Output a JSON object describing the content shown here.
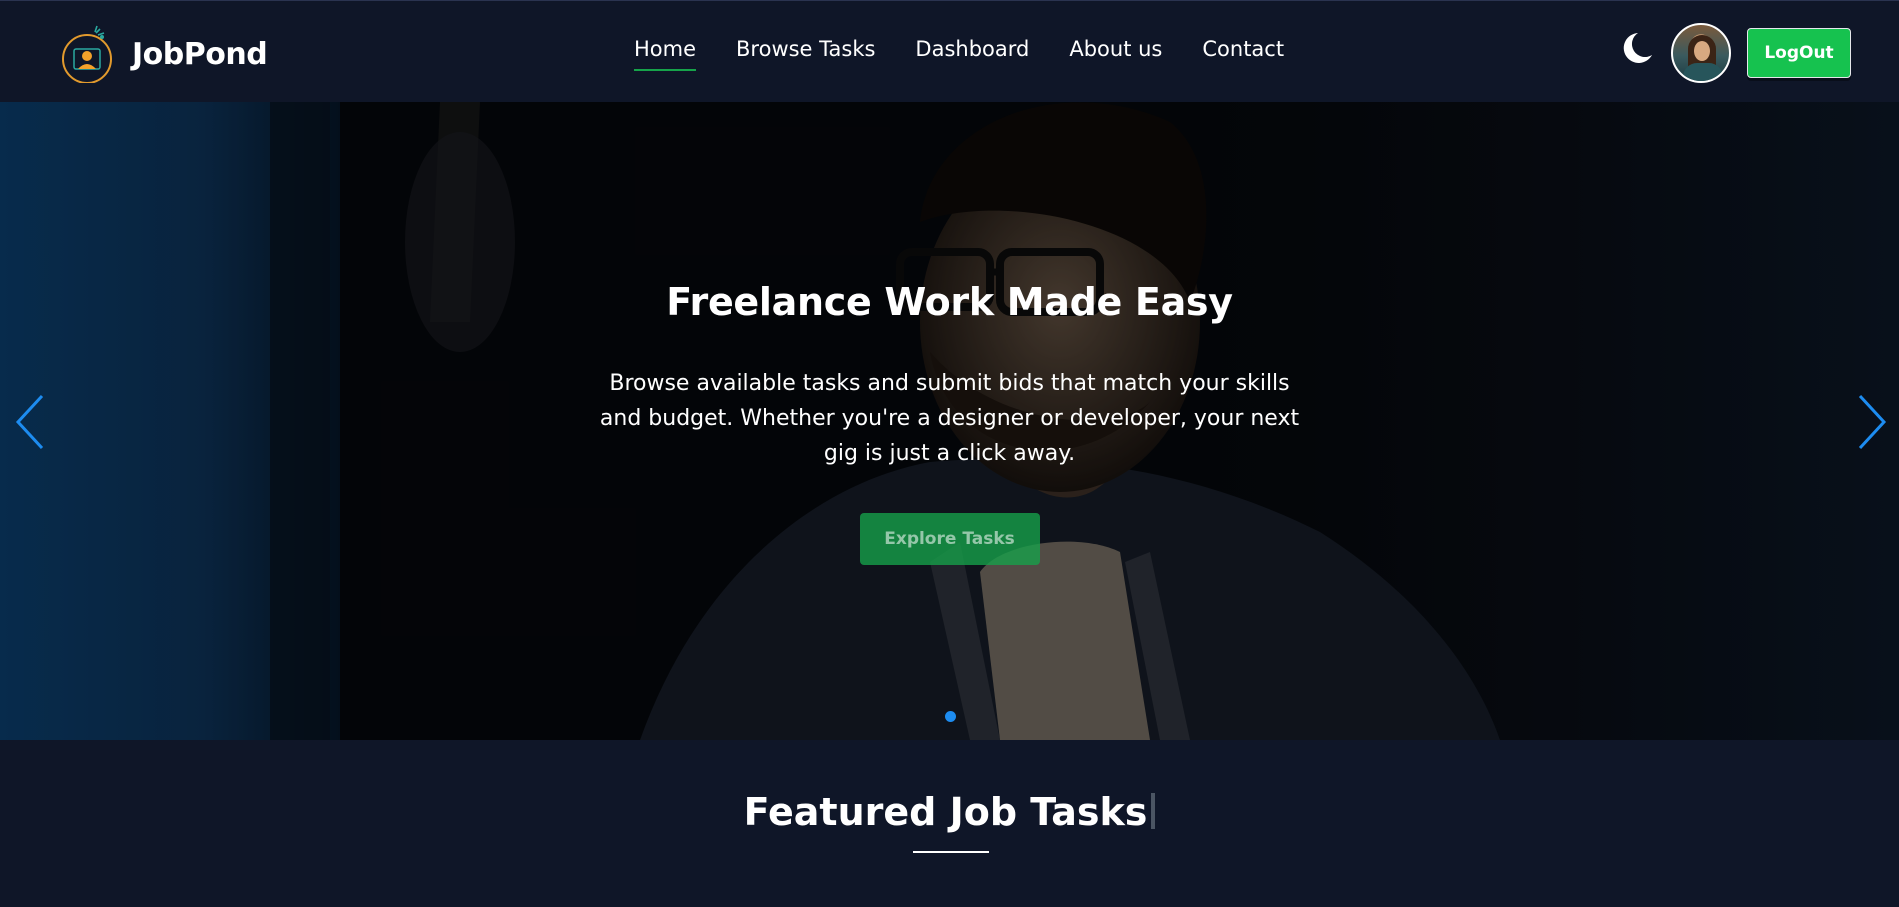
{
  "navbar": {
    "brand": "JobPond",
    "links": [
      {
        "label": "Home",
        "active": true
      },
      {
        "label": "Browse Tasks",
        "active": false
      },
      {
        "label": "Dashboard",
        "active": false
      },
      {
        "label": "About us",
        "active": false
      },
      {
        "label": "Contact",
        "active": false
      }
    ],
    "theme_icon": "moon-icon",
    "logout_label": "LogOut",
    "colors": {
      "background": "#0f1628",
      "accent": "#16c24f",
      "logo_ring": "#e29a2d"
    }
  },
  "hero": {
    "title": "Freelance Work Made Easy",
    "description": "Browse available tasks and submit bids that match your skills and budget. Whether you're a designer or developer, your next gig is just a click away.",
    "cta_label": "Explore Tasks",
    "prev_icon": "chevron-left-icon",
    "next_icon": "chevron-right-icon",
    "slide_count": 1,
    "active_slide": 1,
    "arrow_color": "#1d8cf0"
  },
  "featured": {
    "title": "Featured Job Tasks"
  }
}
